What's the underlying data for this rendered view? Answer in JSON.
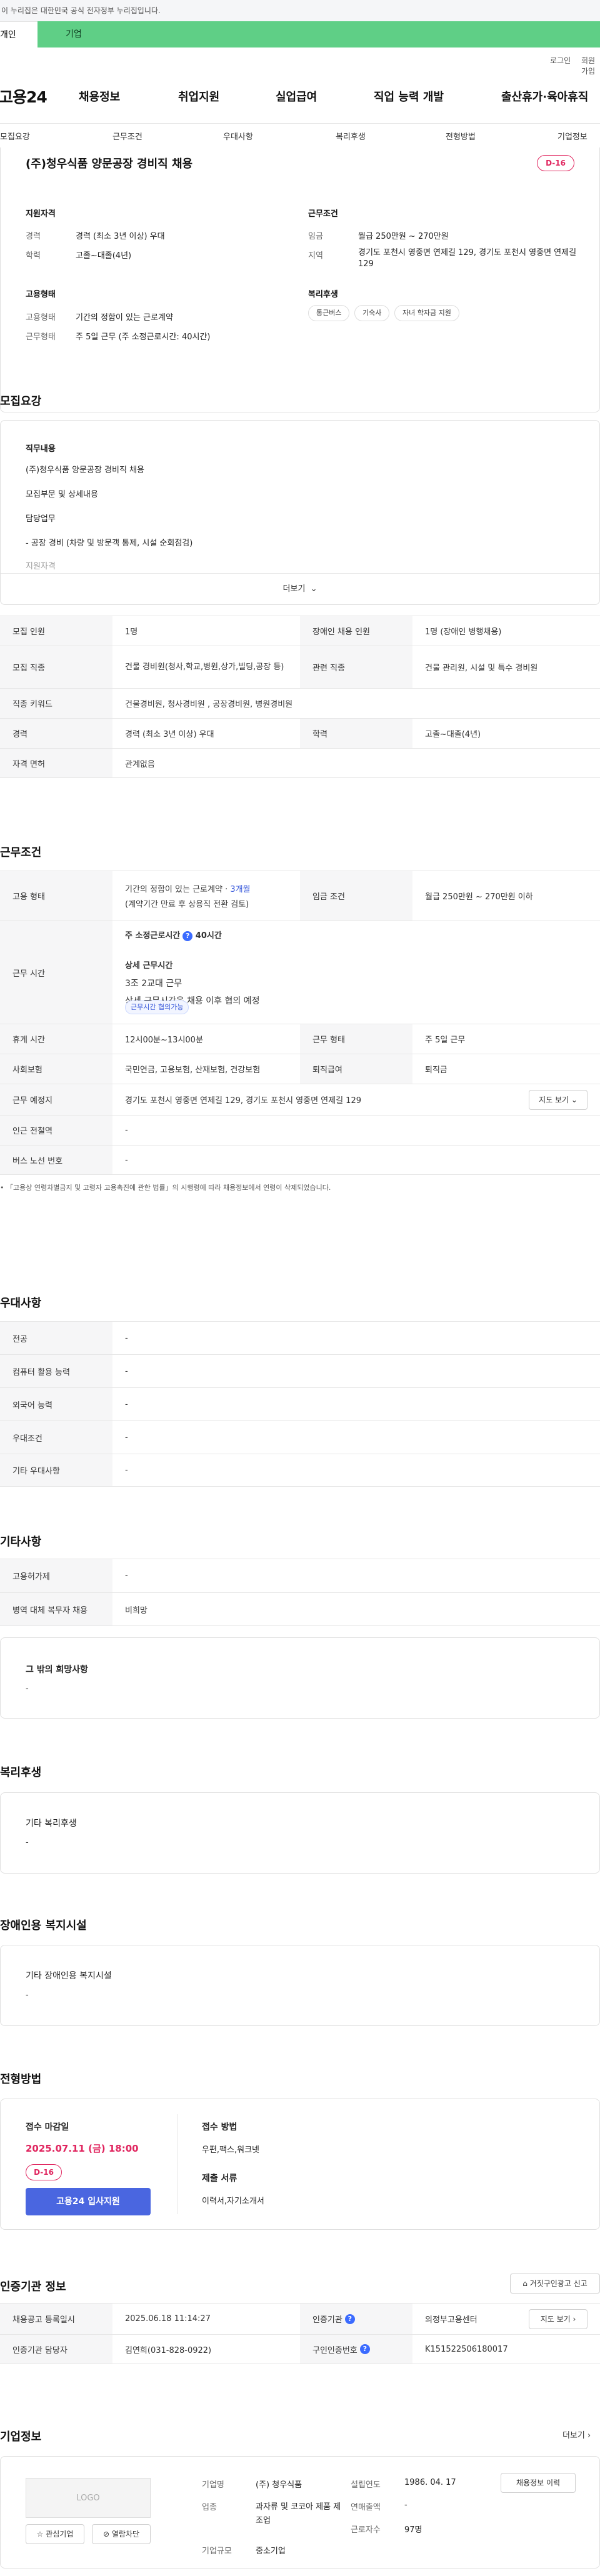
{
  "gov_notice": "이 누리집은 대한민국 공식 전자정부 누리집입니다.",
  "tabs": {
    "personal": "개인",
    "corporate": "기업"
  },
  "topmenu": {
    "login": "로그인",
    "join": "회원가입"
  },
  "gnb": {
    "logo": "고용24",
    "items": [
      "채용정보",
      "취업지원",
      "실업급여",
      "직업 능력 개발",
      "출산휴가·육아휴직"
    ]
  },
  "subnav": [
    "모집요강",
    "근무조건",
    "우대사항",
    "복리후생",
    "전형방법",
    "기업정보"
  ],
  "job": {
    "title": "(주)청우식품 양문공장 경비직 채용",
    "dday": "D-16",
    "qualification": {
      "heading": "지원자격",
      "rows": [
        {
          "k": "경력",
          "v": "경력 (최소 3년 이상) 우대"
        },
        {
          "k": "학력",
          "v": "고졸~대졸(4년)"
        }
      ]
    },
    "conditions": {
      "heading": "근무조건",
      "rows": [
        {
          "k": "임금",
          "v": "월급 250만원 ~ 270만원"
        },
        {
          "k": "지역",
          "v": "경기도 포천시 영중면 연제길 129, 경기도 포천시 영중면 연제길 129"
        }
      ]
    },
    "employment": {
      "heading": "고용형태",
      "rows": [
        {
          "k": "고용형태",
          "v": "기간의 정함이 있는 근로계약"
        },
        {
          "k": "근무형태",
          "v": "주 5일 근무 (주 소정근로시간: 40시간)"
        }
      ]
    },
    "welfare": {
      "heading": "복리후생",
      "chips": [
        "통근버스",
        "기숙사",
        "자녀 학자금 지원"
      ]
    }
  },
  "recruit": {
    "heading": "모집요강",
    "desc_title": "직무내용",
    "desc_lines": [
      "(주)청우식품 양문공장 경비직 채용",
      "모집부문 및 상세내용",
      "담당업무",
      "- 공장 경비 (차량 및 방문객 통제, 시설 순회점검)",
      "지원자격"
    ],
    "more": "더보기",
    "rows": [
      {
        "k1": "모집 인원",
        "v1": "1명",
        "k2": "장애인 채용 인원",
        "v2": "1명 (장애인 병행채용)"
      },
      {
        "k1": "모집 직종",
        "v1": "건물 경비원(청사,학교,병원,상가,빌딩,공장 등)",
        "k2": "관련 직종",
        "v2": "건물 관리원, 시설 및 특수 경비원"
      },
      {
        "k1": "직종 키워드",
        "v1": "건물경비원, 청사경비원 , 공장경비원, 병원경비원",
        "k2": "",
        "v2": ""
      },
      {
        "k1": "경력",
        "v1": "경력 (최소 3년 이상) 우대",
        "k2": "학력",
        "v2": "고졸~대졸(4년)"
      },
      {
        "k1": "자격 면허",
        "v1": "관계없음",
        "k2": "",
        "v2": ""
      }
    ]
  },
  "work": {
    "heading": "근무조건",
    "emp_type_label": "고용 형태",
    "emp_type_value": "기간의 정함이 있는 근로계약",
    "emp_period": "3개월",
    "emp_note": "(계약기간 만료 후 상용직 전환 검토)",
    "wage_label": "임금 조건",
    "wage_value": "월급 250만원 ~ 270만원 이하",
    "hours_label": "근무 시간",
    "hours_total_label": "주 소정근로시간",
    "hours_total_value": "40시간",
    "hours_detail_title": "상세 근무시간",
    "hours_detail_1": "3조 2교대 근무",
    "hours_detail_2": "상세 근무시간은 채용 이후 협의 예정",
    "hours_pill": "근무시간 협의가능",
    "rows": [
      {
        "k1": "휴게 시간",
        "v1": "12시00분~13시00분",
        "k2": "근무 형태",
        "v2": "주 5일 근무"
      },
      {
        "k1": "사회보험",
        "v1": "국민연금, 고용보험, 산재보험, 건강보험",
        "k2": "퇴직급여",
        "v2": "퇴직금"
      }
    ],
    "location_label": "근무 예정지",
    "location_value": "경기도 포천시 영중면 연제길 129, 경기도 포천시 영중면 연제길 129",
    "map_btn": "지도 보기",
    "station_label": "인근 전철역",
    "station_value": "-",
    "bus_label": "버스 노선 번호",
    "bus_value": "-",
    "notice": "「고용상 연령차별금지 및 고령자 고용촉진에 관한 법률」의 시행령에 따라 채용정보에서 연령이 삭제되었습니다."
  },
  "prefer": {
    "heading": "우대사항",
    "rows": [
      {
        "k": "전공",
        "v": "-"
      },
      {
        "k": "컴퓨터 활용 능력",
        "v": "-"
      },
      {
        "k": "외국어 능력",
        "v": "-"
      },
      {
        "k": "우대조건",
        "v": "-"
      },
      {
        "k": "기타 우대사항",
        "v": "-"
      }
    ]
  },
  "etc": {
    "heading": "기타사항",
    "rows": [
      {
        "k": "고용허가제",
        "v": "-"
      },
      {
        "k": "병역 대체 복무자 채용",
        "v": "비희망"
      }
    ],
    "hope_title": "그 밖의 희망사항",
    "hope_value": "-"
  },
  "welfare": {
    "heading": "복리후생",
    "title": "기타 복리후생",
    "value": "-"
  },
  "disabled": {
    "heading": "장애인용 복지시설",
    "title": "기타 장애인용 복지시설",
    "value": "-"
  },
  "process": {
    "heading": "전형방법",
    "deadline_label": "접수 마감일",
    "deadline": "2025.07.11 (금) 18:00",
    "dday": "D-16",
    "apply_btn": "고용24 입사지원",
    "method_label": "접수 방법",
    "method_value": "우편,팩스,워크넷",
    "docs_label": "제출 서류",
    "docs_value": "이력서,자기소개서"
  },
  "cert": {
    "heading": "인증기관 정보",
    "report_btn": "거짓구인광고 신고",
    "rows": [
      {
        "k1": "채용공고 등록일시",
        "v1": "2025.06.18 11:14:27",
        "k2": "인증기관",
        "v2": "의정부고용센터"
      },
      {
        "k1": "인증기관 담당자",
        "v1": "김연희(031-828-0922)",
        "k2": "구인인증번호",
        "v2": "K151522506180017"
      }
    ],
    "map_btn": "지도 보기"
  },
  "company": {
    "heading": "기업정보",
    "more": "더보기",
    "logo": "LOGO",
    "fav_btn": "관심기업",
    "block_btn": "열람차단",
    "name_label": "기업명",
    "name": "(주) 청우식품",
    "industry_label": "업종",
    "industry": "과자류 및 코코아 제품 제조업",
    "size_label": "기업규모",
    "size": "중소기업",
    "founded_label": "설립연도",
    "founded": "1986. 04. 17",
    "sales_label": "연매출액",
    "sales": "-",
    "employees_label": "근로자수",
    "employees": "97명",
    "history_btn": "채용정보 이력"
  }
}
